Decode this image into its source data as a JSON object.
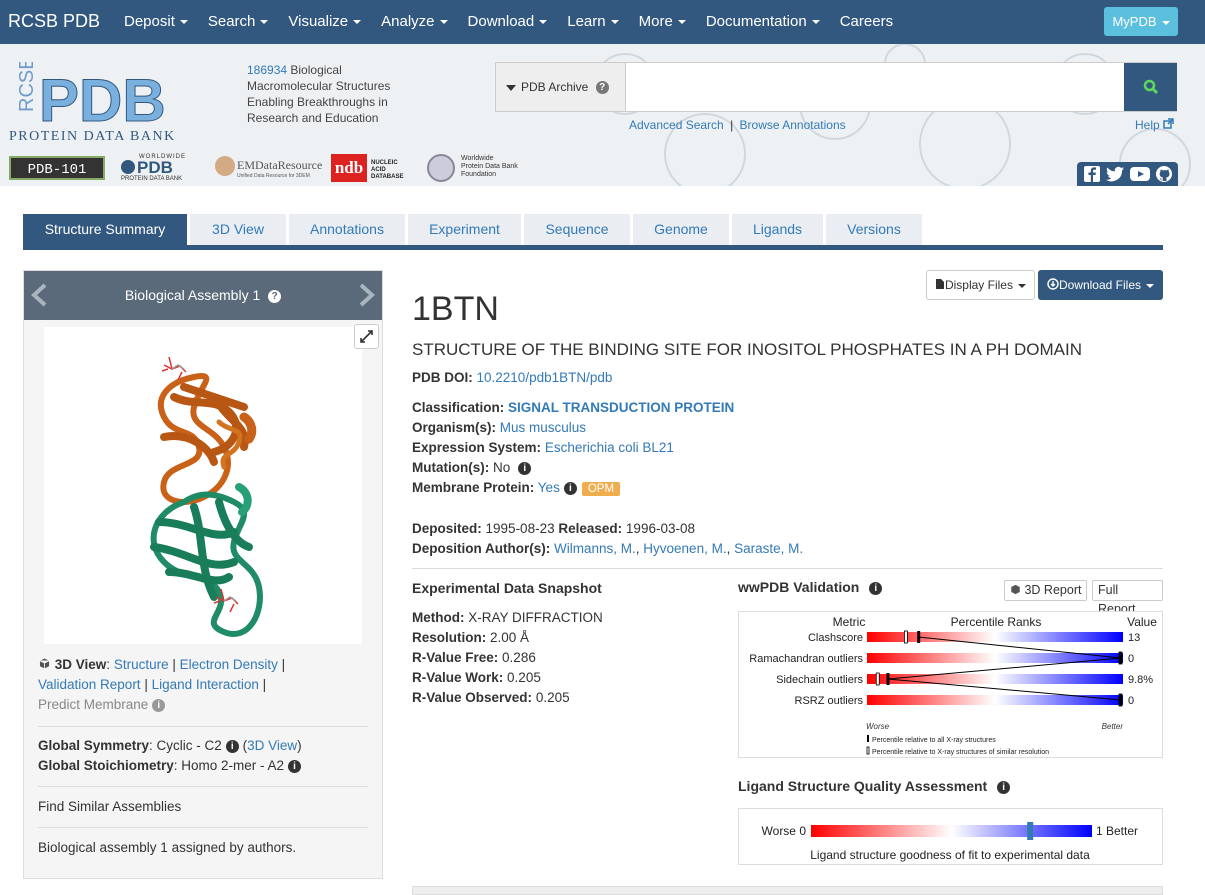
{
  "nav": {
    "brand": "RCSB PDB",
    "items": [
      "Deposit",
      "Search",
      "Visualize",
      "Analyze",
      "Download",
      "Learn",
      "More",
      "Documentation",
      "Careers"
    ],
    "careers": "Careers",
    "mypdb": "MyPDB"
  },
  "header": {
    "logo_rcsb": "RCSB",
    "logo_pdb": "PDB",
    "logo_sub": "PROTEIN DATA BANK",
    "count": "186934",
    "tag1": " Biological",
    "tag2": "Macromolecular Structures",
    "tag3": "Enabling Breakthroughs in",
    "tag4": "Research and Education",
    "search_dropdown": "PDB Archive",
    "advanced_search": "Advanced Search",
    "browse_annotations": "Browse Annotations",
    "separator": "|",
    "help": "Help",
    "partners": {
      "pdb101": "PDB-101",
      "wwpdb_top": "WORLDWIDE",
      "wwpdb": "PDB",
      "wwpdb_sub": "PROTEIN DATA BANK",
      "emdb": "EMDataResource",
      "emdb_sub": "Unified Data Resource for 3DEM",
      "ndb": "ndb",
      "ndb_sub": "NUCLEIC ACID DATABASE",
      "foundation1": "Worldwide",
      "foundation2": "Protein Data Bank",
      "foundation3": "Foundation"
    }
  },
  "tabs": [
    "Structure Summary",
    "3D View",
    "Annotations",
    "Experiment",
    "Sequence",
    "Genome",
    "Ligands",
    "Versions"
  ],
  "left": {
    "assembly_title": "Biological Assembly 1",
    "view_label": "3D View",
    "links1": "Structure",
    "links2": "Electron Density",
    "links3": "Validation Report",
    "links4": "Ligand Interaction",
    "predict": "Predict Membrane",
    "sym_label": "Global Symmetry",
    "sym_value": ": Cyclic - C2",
    "sym_link": "3D View",
    "stoich_label": "Global Stoichiometry",
    "stoich_value": ": Homo 2-mer - A2",
    "find_similar": "Find Similar Assemblies",
    "assigned": "Biological assembly 1 assigned by authors."
  },
  "main": {
    "display_files": "Display Files",
    "download_files": "Download Files",
    "pdb_id": "1BTN",
    "title": "STRUCTURE OF THE BINDING SITE FOR INOSITOL PHOSPHATES IN A PH DOMAIN",
    "doi_label": "PDB DOI:",
    "doi": "10.2210/pdb1BTN/pdb",
    "class_label": "Classification:",
    "class_value": "SIGNAL TRANSDUCTION PROTEIN",
    "org_label": "Organism(s):",
    "org_value": "Mus musculus",
    "expr_label": "Expression System:",
    "expr_value": "Escherichia coli BL21",
    "mut_label": "Mutation(s):",
    "mut_value": "No",
    "mem_label": "Membrane Protein:",
    "mem_value": "Yes",
    "opm": "OPM",
    "dep_label": "Deposited:",
    "dep_value": "1995-08-23",
    "rel_label": "Released:",
    "rel_value": "1996-03-08",
    "auth_label": "Deposition Author(s):",
    "authors": [
      "Wilmanns, M.",
      "Hyvoenen, M.",
      "Saraste, M."
    ],
    "comma": ", "
  },
  "snapshot": {
    "title": "Experimental Data Snapshot",
    "method_label": "Method:",
    "method": "X-RAY DIFFRACTION",
    "res_label": "Resolution:",
    "res": "2.00 Å",
    "rfree_label": "R-Value Free:",
    "rfree": "0.286",
    "rwork_label": "R-Value Work:",
    "rwork": "0.205",
    "robs_label": "R-Value Observed:",
    "robs": "0.205"
  },
  "validation": {
    "title": "wwPDB Validation",
    "report3d": "3D Report",
    "full": "Full Report",
    "col_metric": "Metric",
    "col_pct": "Percentile Ranks",
    "col_value": "Value",
    "metrics": [
      {
        "name": "Clashscore",
        "value": "13",
        "pct_all": 0.2,
        "pct_sim": 0.15
      },
      {
        "name": "Ramachandran outliers",
        "value": "0",
        "pct_all": 1.0,
        "pct_sim": 1.0
      },
      {
        "name": "Sidechain outliers",
        "value": "9.8%",
        "pct_all": 0.08,
        "pct_sim": 0.04
      },
      {
        "name": "RSRZ outliers",
        "value": "0",
        "pct_all": 1.0,
        "pct_sim": 1.0
      }
    ],
    "worse": "Worse",
    "better": "Better",
    "legend1": "Percentile relative to all X-ray structures",
    "legend2": "Percentile relative to X-ray structures of similar resolution"
  },
  "ligand": {
    "title": "Ligand Structure Quality Assessment",
    "worse": "Worse 0",
    "better": "1 Better",
    "caption": "Ligand structure goodness of fit to experimental data",
    "marker": 0.78
  }
}
